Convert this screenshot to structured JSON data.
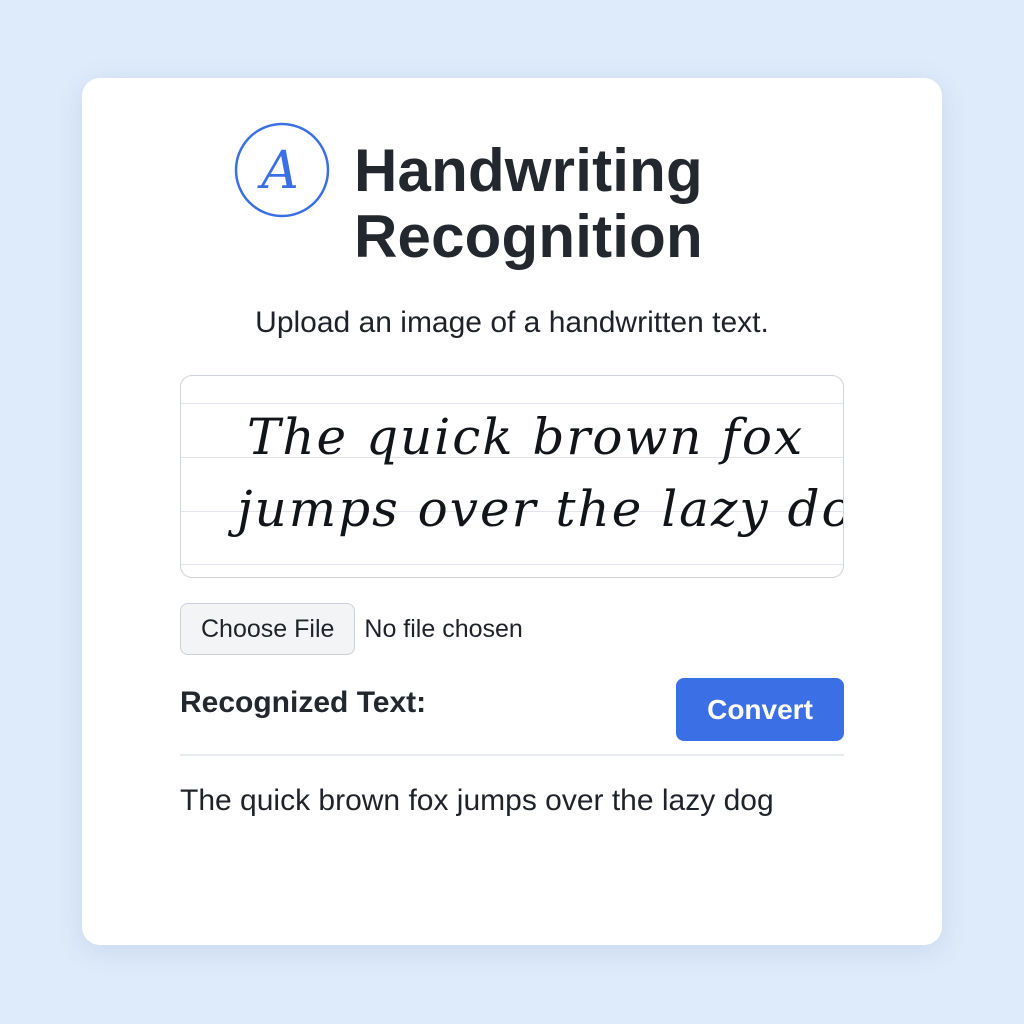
{
  "header": {
    "logo_letter": "A",
    "title_line1": "Handwriting",
    "title_line2": "Recognition",
    "accent_color": "#3b6fe6"
  },
  "upload": {
    "instruction": "Upload an image of a handwritten text.",
    "sample_line1": "The quick brown fox",
    "sample_line2": "jumps over the lazy dog",
    "file_button_label": "Choose File",
    "file_status": "No file chosen"
  },
  "result": {
    "label": "Recognized Text:",
    "convert_label": "Convert",
    "text": "The quick brown fox jumps over the lazy dog"
  }
}
